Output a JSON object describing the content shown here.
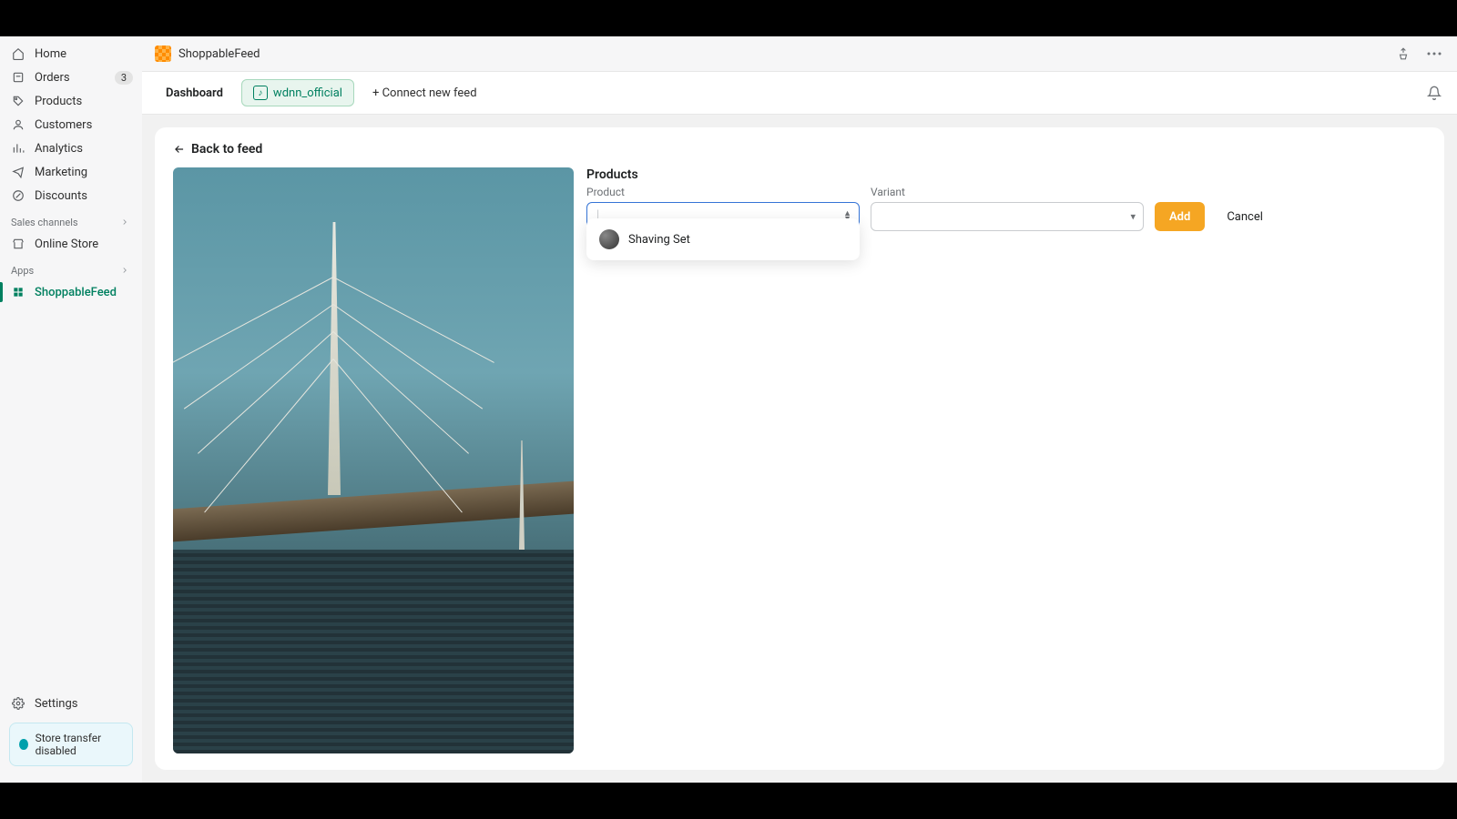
{
  "app": {
    "name": "ShoppableFeed"
  },
  "sidebar": {
    "nav": [
      {
        "label": "Home"
      },
      {
        "label": "Orders",
        "badge": "3"
      },
      {
        "label": "Products"
      },
      {
        "label": "Customers"
      },
      {
        "label": "Analytics"
      },
      {
        "label": "Marketing"
      },
      {
        "label": "Discounts"
      }
    ],
    "sales_section": "Sales channels",
    "sales_items": [
      {
        "label": "Online Store"
      }
    ],
    "apps_section": "Apps",
    "apps_items": [
      {
        "label": "ShoppableFeed"
      }
    ],
    "settings": "Settings",
    "notice": "Store transfer disabled"
  },
  "tabs": {
    "dashboard": "Dashboard",
    "feed": "wdnn_official",
    "connect": "+ Connect new feed"
  },
  "page": {
    "back": "Back to feed",
    "products_title": "Products",
    "product_label": "Product",
    "variant_label": "Variant",
    "add": "Add",
    "cancel": "Cancel",
    "dropdown_item": "Shaving Set"
  }
}
